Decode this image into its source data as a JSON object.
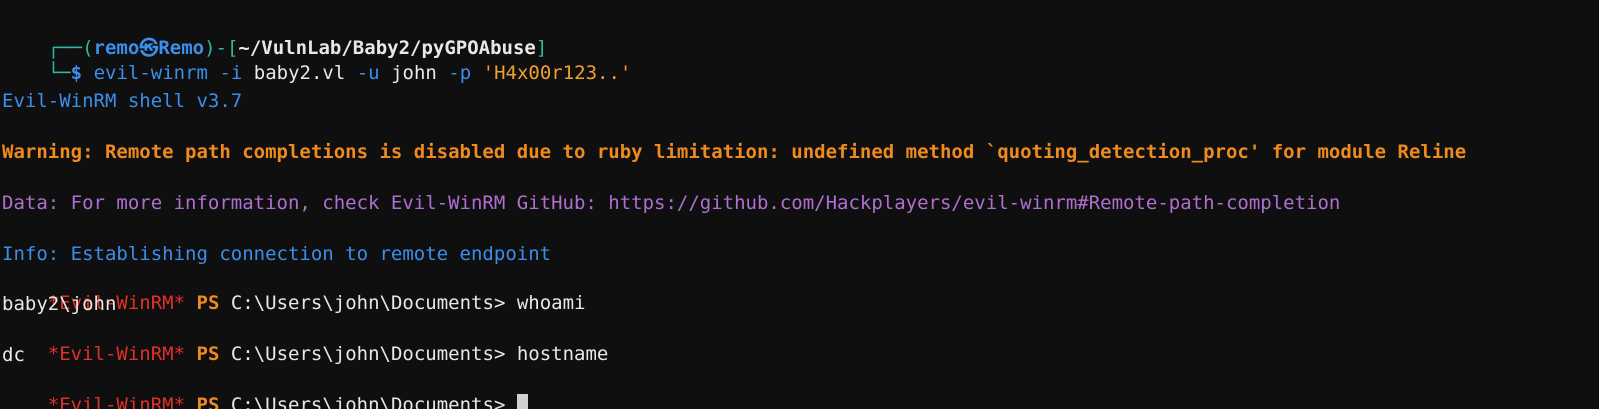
{
  "prompt": {
    "corner_top": "┌──",
    "open": "(",
    "user": "remo",
    "sep": "㉿",
    "host": "Remo",
    "close": ")-[",
    "path": "~/VulnLab/Baby2/pyGPOAbuse",
    "bracket_close": "]",
    "corner_bottom": "└─",
    "dollar": "$",
    "cmd_name": "evil-winrm",
    "arg1_flag": "-i",
    "arg1_value": "baby2.vl",
    "arg2_flag": "-u",
    "arg2_value": "john",
    "arg3_flag": "-p",
    "arg3_value": "'H4x00r123..'"
  },
  "output": {
    "shell_version": "Evil-WinRM shell v3.7",
    "warning": "Warning: Remote path completions is disabled due to ruby limitation: undefined method `quoting_detection_proc' for module Reline",
    "data_line": "Data: For more information, check Evil-WinRM GitHub: https://github.com/Hackplayers/evil-winrm#Remote-path-completion",
    "info_line": "Info: Establishing connection to remote endpoint"
  },
  "session": {
    "tag": "*Evil-WinRM*",
    "ps": "PS",
    "path": "C:\\Users\\john\\Documents>",
    "cmd1": "whoami",
    "out1": "baby2\\john",
    "cmd2": "hostname",
    "out2": "dc"
  },
  "colors": {
    "background": "#0f0f0f",
    "blue": "#3b8eea",
    "orange": "#ee8a1e",
    "purple": "#b06fd0",
    "red": "#e0302a",
    "teal": "#2fb7a3"
  }
}
